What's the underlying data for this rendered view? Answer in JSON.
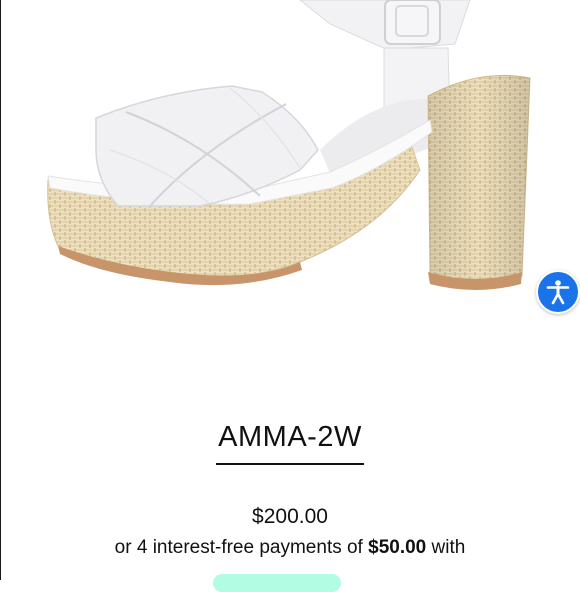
{
  "product": {
    "name": "AMMA-2W",
    "price": "$200.00",
    "installments": {
      "prefix": "or 4 interest-free payments of",
      "amount": "$50.00",
      "suffix": "with"
    }
  },
  "icons": {
    "accessibility": "accessibility-icon"
  },
  "colors": {
    "accessibility_button": "#1a73e8",
    "pay_badge": "#b2fce4",
    "rattan": "#ecdcb6",
    "sole": "#c8946a",
    "leather": "#f2f2f4"
  }
}
